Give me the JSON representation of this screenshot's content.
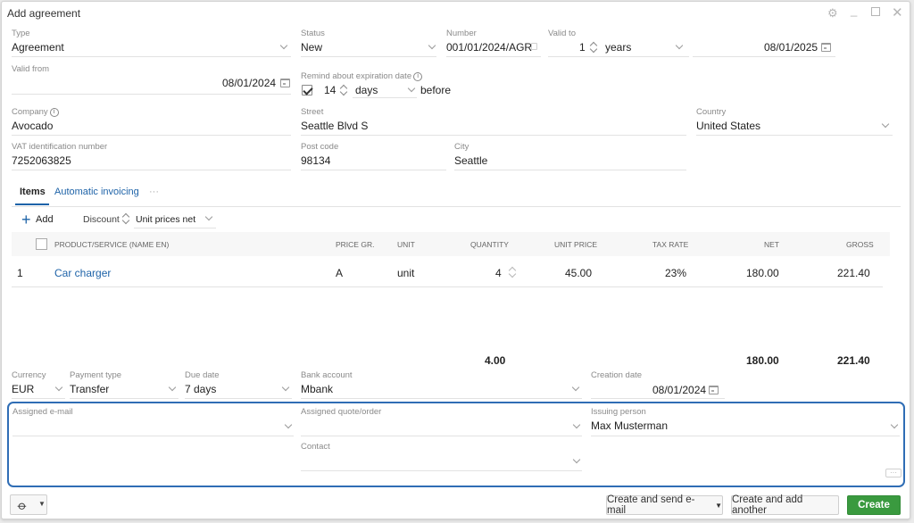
{
  "window": {
    "title": "Add agreement"
  },
  "header": {
    "type": {
      "label": "Type",
      "value": "Agreement"
    },
    "status": {
      "label": "Status",
      "value": "New"
    },
    "number": {
      "label": "Number",
      "value": "001/01/2024/AGR"
    },
    "valid_to": {
      "label": "Valid to",
      "count": "1",
      "unit": "years",
      "date": "08/01/2025"
    },
    "valid_from": {
      "label": "Valid from",
      "date": "08/01/2024"
    },
    "remind": {
      "label": "Remind about expiration date",
      "checked": true,
      "count": "14",
      "unit": "days",
      "suffix": "before"
    }
  },
  "company": {
    "company": {
      "label": "Company",
      "value": "Avocado"
    },
    "street": {
      "label": "Street",
      "value": "Seattle Blvd S"
    },
    "country": {
      "label": "Country",
      "value": "United States"
    },
    "vat": {
      "label": "VAT identification number",
      "value": "7252063825"
    },
    "post_code": {
      "label": "Post code",
      "value": "98134"
    },
    "city": {
      "label": "City",
      "value": "Seattle"
    }
  },
  "tabs": [
    {
      "label": "Items",
      "active": true
    },
    {
      "label": "Automatic invoicing",
      "active": false
    },
    {
      "label": "···",
      "active": false
    }
  ],
  "items_toolbar": {
    "add_label": "Add",
    "discount_label": "Discount",
    "price_mode": "Unit prices net"
  },
  "items_table": {
    "columns": [
      "PRODUCT/SERVICE (NAME EN)",
      "PRICE GR.",
      "UNIT",
      "QUANTITY",
      "UNIT PRICE",
      "TAX RATE",
      "NET",
      "GROSS"
    ],
    "rows": [
      {
        "no": "1",
        "product": "Car charger",
        "price_group": "A",
        "unit": "unit",
        "quantity": "4",
        "unit_price": "45.00",
        "tax_rate": "23%",
        "net": "180.00",
        "gross": "221.40"
      }
    ],
    "totals": {
      "quantity": "4.00",
      "net": "180.00",
      "gross": "221.40"
    }
  },
  "payment": {
    "currency": {
      "label": "Currency",
      "value": "EUR"
    },
    "payment_type": {
      "label": "Payment type",
      "value": "Transfer"
    },
    "due_date": {
      "label": "Due date",
      "value": "7 days"
    },
    "bank_account": {
      "label": "Bank account",
      "value": "Mbank"
    },
    "creation_date": {
      "label": "Creation date",
      "value": "08/01/2024"
    }
  },
  "assign": {
    "email": {
      "label": "Assigned e-mail",
      "value": ""
    },
    "quote": {
      "label": "Assigned quote/order",
      "value": ""
    },
    "issuer": {
      "label": "Issuing person",
      "value": "Max Musterman"
    },
    "contact": {
      "label": "Contact",
      "value": ""
    },
    "more": "···"
  },
  "footer": {
    "send_label": "Create and send e-mail",
    "add_another_label": "Create and add another",
    "create_label": "Create"
  },
  "colors": {
    "accent": "#1e63a8",
    "highlight_border": "#2f6db5",
    "create_button": "#3a9a3f"
  }
}
